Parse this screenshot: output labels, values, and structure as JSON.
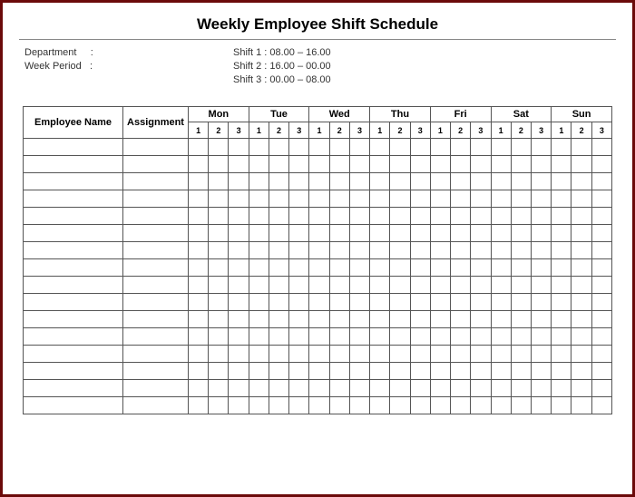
{
  "title": "Weekly Employee Shift Schedule",
  "info": {
    "department_label": "Department",
    "department_sep": ":",
    "week_period_label": "Week Period",
    "week_period_sep": ":",
    "shift1_label": "Shift 1 :",
    "shift1_time": "08.00  –  16.00",
    "shift2_label": "Shift 2 :",
    "shift2_time": "16.00  –  00.00",
    "shift3_label": "Shift 3 :",
    "shift3_time": "00.00  –  08.00"
  },
  "headers": {
    "employee_name": "Employee Name",
    "assignment": "Assignment",
    "days": [
      "Mon",
      "Tue",
      "Wed",
      "Thu",
      "Fri",
      "Sat",
      "Sun"
    ],
    "shifts": [
      "1",
      "2",
      "3"
    ]
  },
  "rows": [
    {},
    {},
    {},
    {},
    {},
    {},
    {},
    {},
    {},
    {},
    {},
    {},
    {},
    {},
    {},
    {}
  ]
}
